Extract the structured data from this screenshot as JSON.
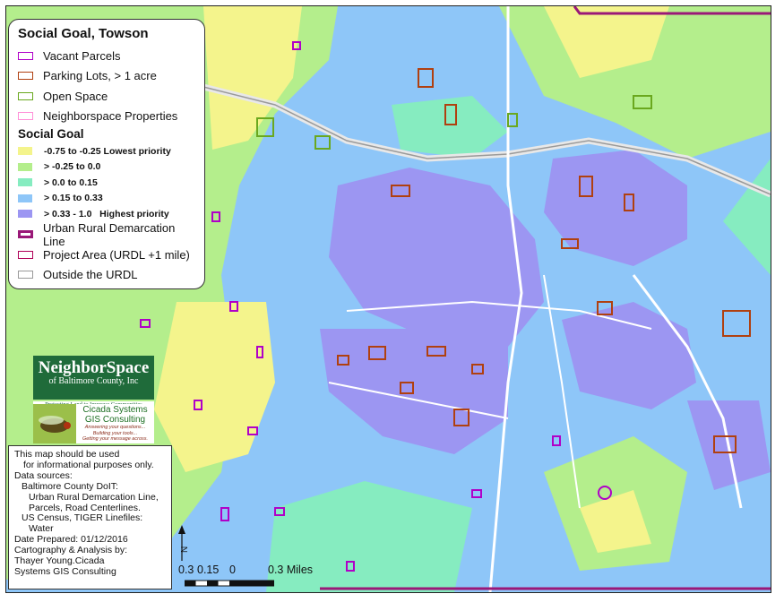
{
  "legend": {
    "title": "Social Goal, Towson",
    "layers": [
      {
        "label": "Vacant Parcels",
        "color": "#b000c8"
      },
      {
        "label": "Parking Lots, > 1 acre",
        "color": "#b04010"
      },
      {
        "label": "Open Space",
        "color": "#6aa81e"
      },
      {
        "label": "Neighborspace Properties",
        "color": "#ff8fd8"
      }
    ],
    "ramp_title": "Social Goal",
    "ramp": [
      {
        "label": "-0.75 to -0.25 Lowest priority",
        "color": "#f4f48c"
      },
      {
        "label": "> -0.25 to 0.0",
        "color": "#b4ee8c"
      },
      {
        "label": "> 0.0 to 0.15",
        "color": "#86ecc0"
      },
      {
        "label": "> 0.15 to 0.33",
        "color": "#8ec6f8"
      },
      {
        "label": "> 0.33 - 1.0   Highest priority",
        "color": "#9c96f2"
      }
    ],
    "boundaries": [
      {
        "label": "Urban Rural Demarcation Line",
        "color": "#9a1878"
      },
      {
        "label": "Project Area (URDL +1 mile)",
        "color": "#b00058"
      },
      {
        "label": "Outside the URDL",
        "color": "#999999"
      }
    ]
  },
  "logo_neighborspace": {
    "name": "NeighborSpace",
    "sub": "of Baltimore County, Inc",
    "tagline": "Protecting Land to Improve Communities"
  },
  "logo_cicada": {
    "name_line1": "Cicada Systems",
    "name_line2": "GIS Consulting",
    "tagline_line1": "Answering your questions...",
    "tagline_line2": "Building your tools...",
    "tagline_line3": "Getting your message across."
  },
  "notes": {
    "line1": "This map should be used",
    "line2": "for informational purposes only.",
    "line3": "Data sources:",
    "line4": "Baltimore County DoIT:",
    "line5": "Urban Rural Demarcation Line,",
    "line6": "Parcels, Road Centerlines.",
    "line7": "US Census, TIGER Linefiles:",
    "line8": "Water",
    "line9": "Date Prepared: 01/12/2016",
    "line10": "Cartography & Analysis by:",
    "line11": "Thayer Young.Cicada",
    "line12": "Systems GIS Consulting"
  },
  "scale": {
    "north_label": "N",
    "labels": [
      "0.3",
      "0.15",
      "0",
      "0.3 Miles"
    ]
  }
}
